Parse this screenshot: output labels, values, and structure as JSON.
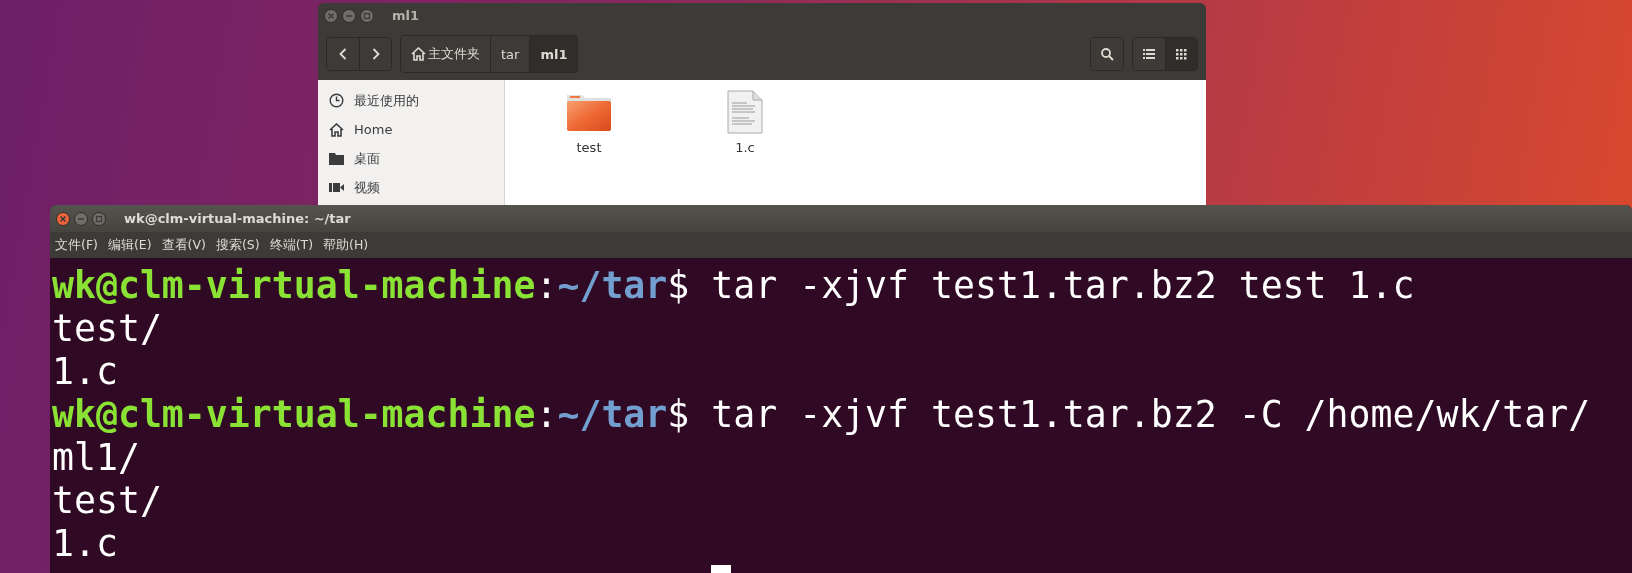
{
  "file_manager": {
    "title": "ml1",
    "path": [
      {
        "label": "主文件夹",
        "kind": "home",
        "selected": false
      },
      {
        "label": "tar",
        "kind": "folder",
        "selected": false
      },
      {
        "label": "ml1",
        "kind": "folder",
        "selected": true
      }
    ],
    "view_buttons": [
      {
        "kind": "list",
        "selected": false
      },
      {
        "kind": "grid",
        "selected": true
      }
    ],
    "sidebar": {
      "items": [
        {
          "label": "最近使用的",
          "kind": "recent"
        },
        {
          "label": "Home",
          "kind": "home"
        },
        {
          "label": "桌面",
          "kind": "desktop"
        },
        {
          "label": "视频",
          "kind": "videos"
        }
      ]
    },
    "files": [
      {
        "name": "test",
        "kind": "folder"
      },
      {
        "name": "1.c",
        "kind": "document"
      }
    ]
  },
  "terminal": {
    "title": "wk@clm-virtual-machine: ~/tar",
    "menu": [
      "文件(F)",
      "编辑(E)",
      "查看(V)",
      "搜索(S)",
      "终端(T)",
      "帮助(H)"
    ],
    "lines": [
      {
        "kind": "prompt",
        "user_host": "wk@clm-virtual-machine",
        "colon": ":",
        "path": "~/tar",
        "command": "$ tar -xjvf test1.tar.bz2 test 1.c"
      },
      {
        "kind": "output",
        "text": "test/"
      },
      {
        "kind": "output",
        "text": "1.c"
      },
      {
        "kind": "prompt",
        "user_host": "wk@clm-virtual-machine",
        "colon": ":",
        "path": "~/tar",
        "command": "$ tar -xjvf test1.tar.bz2 -C /home/wk/tar/"
      },
      {
        "kind": "output",
        "text": "ml1/"
      },
      {
        "kind": "output",
        "text": "test/"
      },
      {
        "kind": "output",
        "text": "1.c"
      }
    ]
  }
}
